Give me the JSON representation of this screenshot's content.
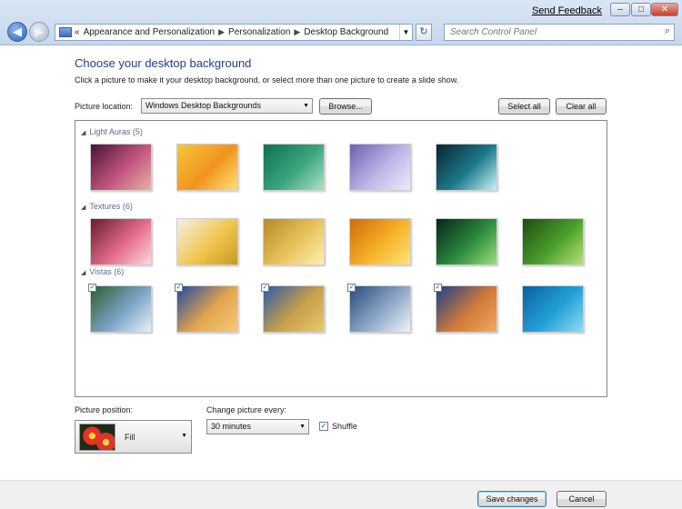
{
  "window": {
    "send_feedback": "Send Feedback",
    "minimize": "–",
    "maximize": "□",
    "close": "✕"
  },
  "nav": {
    "back_icon": "arrow-left-icon",
    "forward_icon": "arrow-right-icon",
    "breadcrumb": [
      "Appearance and Personalization",
      "Personalization",
      "Desktop Background"
    ],
    "overflow": "«",
    "search_placeholder": "Search Control Panel"
  },
  "page": {
    "title": "Choose your desktop background",
    "subtitle": "Click a picture to make it your desktop background, or select more than one picture to create a slide show."
  },
  "location": {
    "label": "Picture location:",
    "value": "Windows Desktop Backgrounds",
    "browse": "Browse...",
    "select_all": "Select all",
    "clear_all": "Clear all"
  },
  "groups": [
    {
      "label": "Light Auras (5)",
      "items": [
        {
          "checked": false,
          "colors": [
            "#4a1236",
            "#c2557f",
            "#e9b0a2"
          ]
        },
        {
          "checked": false,
          "colors": [
            "#f7c53b",
            "#f0941e",
            "#ffe07a"
          ]
        },
        {
          "checked": false,
          "colors": [
            "#0f6e4e",
            "#3aa57e",
            "#aee2c4"
          ]
        },
        {
          "checked": false,
          "colors": [
            "#6f5fb0",
            "#c0b6e8",
            "#f0e9ff"
          ]
        },
        {
          "checked": false,
          "colors": [
            "#0a2230",
            "#1d7b8c",
            "#c7f3f7"
          ]
        }
      ]
    },
    {
      "label": "Textures (6)",
      "items": [
        {
          "checked": false,
          "colors": [
            "#6a1c2c",
            "#e06c88",
            "#ffd7dd"
          ]
        },
        {
          "checked": false,
          "colors": [
            "#f3efe6",
            "#f1c64f",
            "#c89a1f"
          ]
        },
        {
          "checked": false,
          "colors": [
            "#b58a23",
            "#e8c35d",
            "#fff1b3"
          ]
        },
        {
          "checked": false,
          "colors": [
            "#d06a0a",
            "#f6b32a",
            "#ffe37a"
          ]
        },
        {
          "checked": false,
          "colors": [
            "#07251a",
            "#2c8a3d",
            "#9be07d"
          ]
        },
        {
          "checked": false,
          "colors": [
            "#1d4b12",
            "#4c9e2c",
            "#b5e377"
          ]
        }
      ]
    },
    {
      "label": "Vistas (6)",
      "items": [
        {
          "checked": true,
          "colors": [
            "#2f5e2a",
            "#7aa3c6",
            "#e9f1f7"
          ]
        },
        {
          "checked": true,
          "colors": [
            "#1c4aa5",
            "#e3a54e",
            "#f6c97a"
          ]
        },
        {
          "checked": true,
          "colors": [
            "#2b5ba8",
            "#c8a04a",
            "#e6c96e"
          ]
        },
        {
          "checked": true,
          "colors": [
            "#294a7c",
            "#8ea8c8",
            "#f0f4f8"
          ]
        },
        {
          "checked": true,
          "colors": [
            "#1a3f8c",
            "#d07a3a",
            "#f2a95e"
          ]
        },
        {
          "checked": false,
          "colors": [
            "#0a5fa0",
            "#23a0d6",
            "#8fdcf2"
          ]
        }
      ]
    }
  ],
  "position": {
    "label": "Picture position:",
    "value": "Fill"
  },
  "interval": {
    "label": "Change picture every:",
    "value": "30 minutes"
  },
  "shuffle": {
    "label": "Shuffle",
    "checked": true
  },
  "footer": {
    "save": "Save changes",
    "cancel": "Cancel"
  }
}
